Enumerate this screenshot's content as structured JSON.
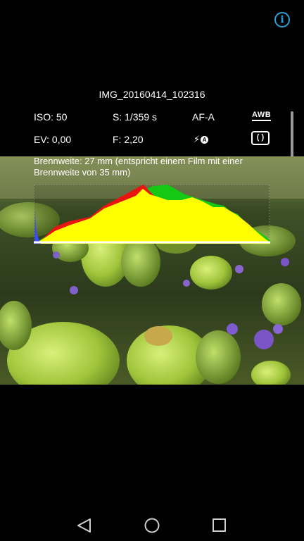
{
  "header": {
    "info_icon": "info-icon",
    "filename": "IMG_20160414_102316"
  },
  "exif": {
    "iso": "ISO: 50",
    "shutter": "S: 1/359 s",
    "focus_mode": "AF-A",
    "white_balance": "AWB",
    "ev": "EV: 0,00",
    "aperture": "F: 2,20",
    "flash_icon": "flash-auto-icon",
    "flash_badge": "A",
    "metering_icon": "metering-icon",
    "focal_length": "Brennweite: 27 mm (entspricht einem Film mit einer Brennweite von 35 mm)"
  },
  "histogram": {
    "colors": {
      "red": "#e8140f",
      "green": "#14c814",
      "yellow": "#ffff00",
      "blue": "#3a4cff",
      "white": "#ffffff"
    }
  },
  "navigation": {
    "back_icon": "back-icon",
    "home_icon": "home-icon",
    "recents_icon": "recents-icon"
  }
}
